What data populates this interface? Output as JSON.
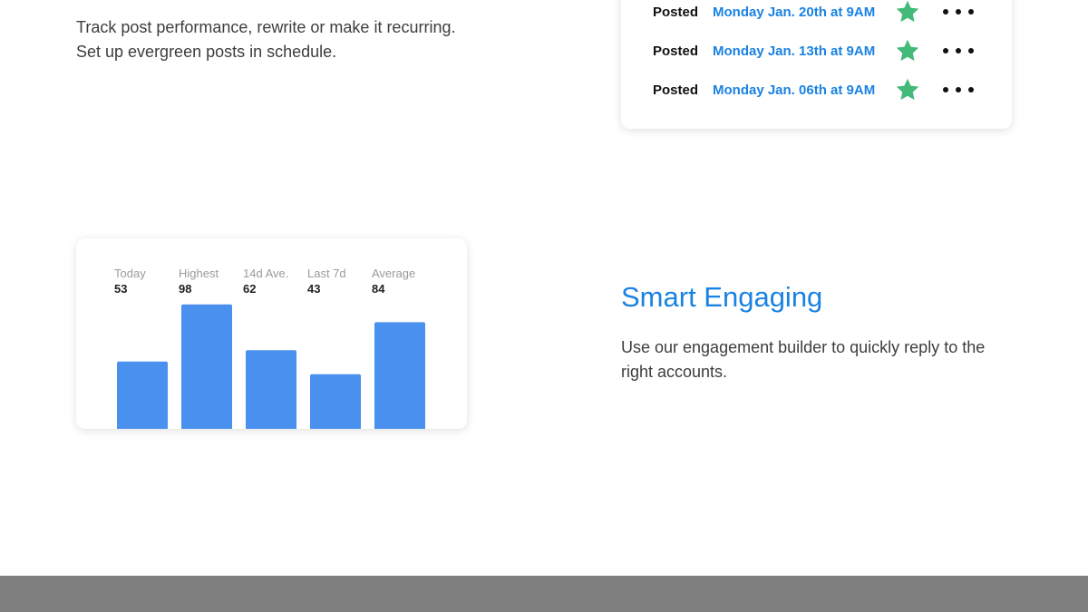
{
  "intro": {
    "line1": "Track post performance, rewrite or make it recurring.",
    "line2": "Set up evergreen posts in schedule."
  },
  "posts": [
    {
      "status": "Posted",
      "date": "Monday Jan. 20th at 9AM"
    },
    {
      "status": "Posted",
      "date": "Monday Jan. 13th at 9AM"
    },
    {
      "status": "Posted",
      "date": "Monday Jan. 06th at 9AM"
    }
  ],
  "icons": {
    "star": "star-icon",
    "more": "more-horizontal-icon"
  },
  "colors": {
    "accent": "#1a82e2",
    "star": "#43b97a",
    "bar": "#4a90ee",
    "footer": "#7f7f7f"
  },
  "chart_data": {
    "type": "bar",
    "categories": [
      "Today",
      "Highest",
      "14d Ave.",
      "Last 7d",
      "Average"
    ],
    "values": [
      53,
      98,
      62,
      43,
      84
    ],
    "value_labels": [
      "53",
      "98",
      "62",
      "43",
      "84"
    ],
    "ylim": [
      0,
      100
    ],
    "grid": false
  },
  "engaging": {
    "title": "Smart Engaging",
    "description": "Use our engagement builder to quickly reply to the right accounts."
  }
}
